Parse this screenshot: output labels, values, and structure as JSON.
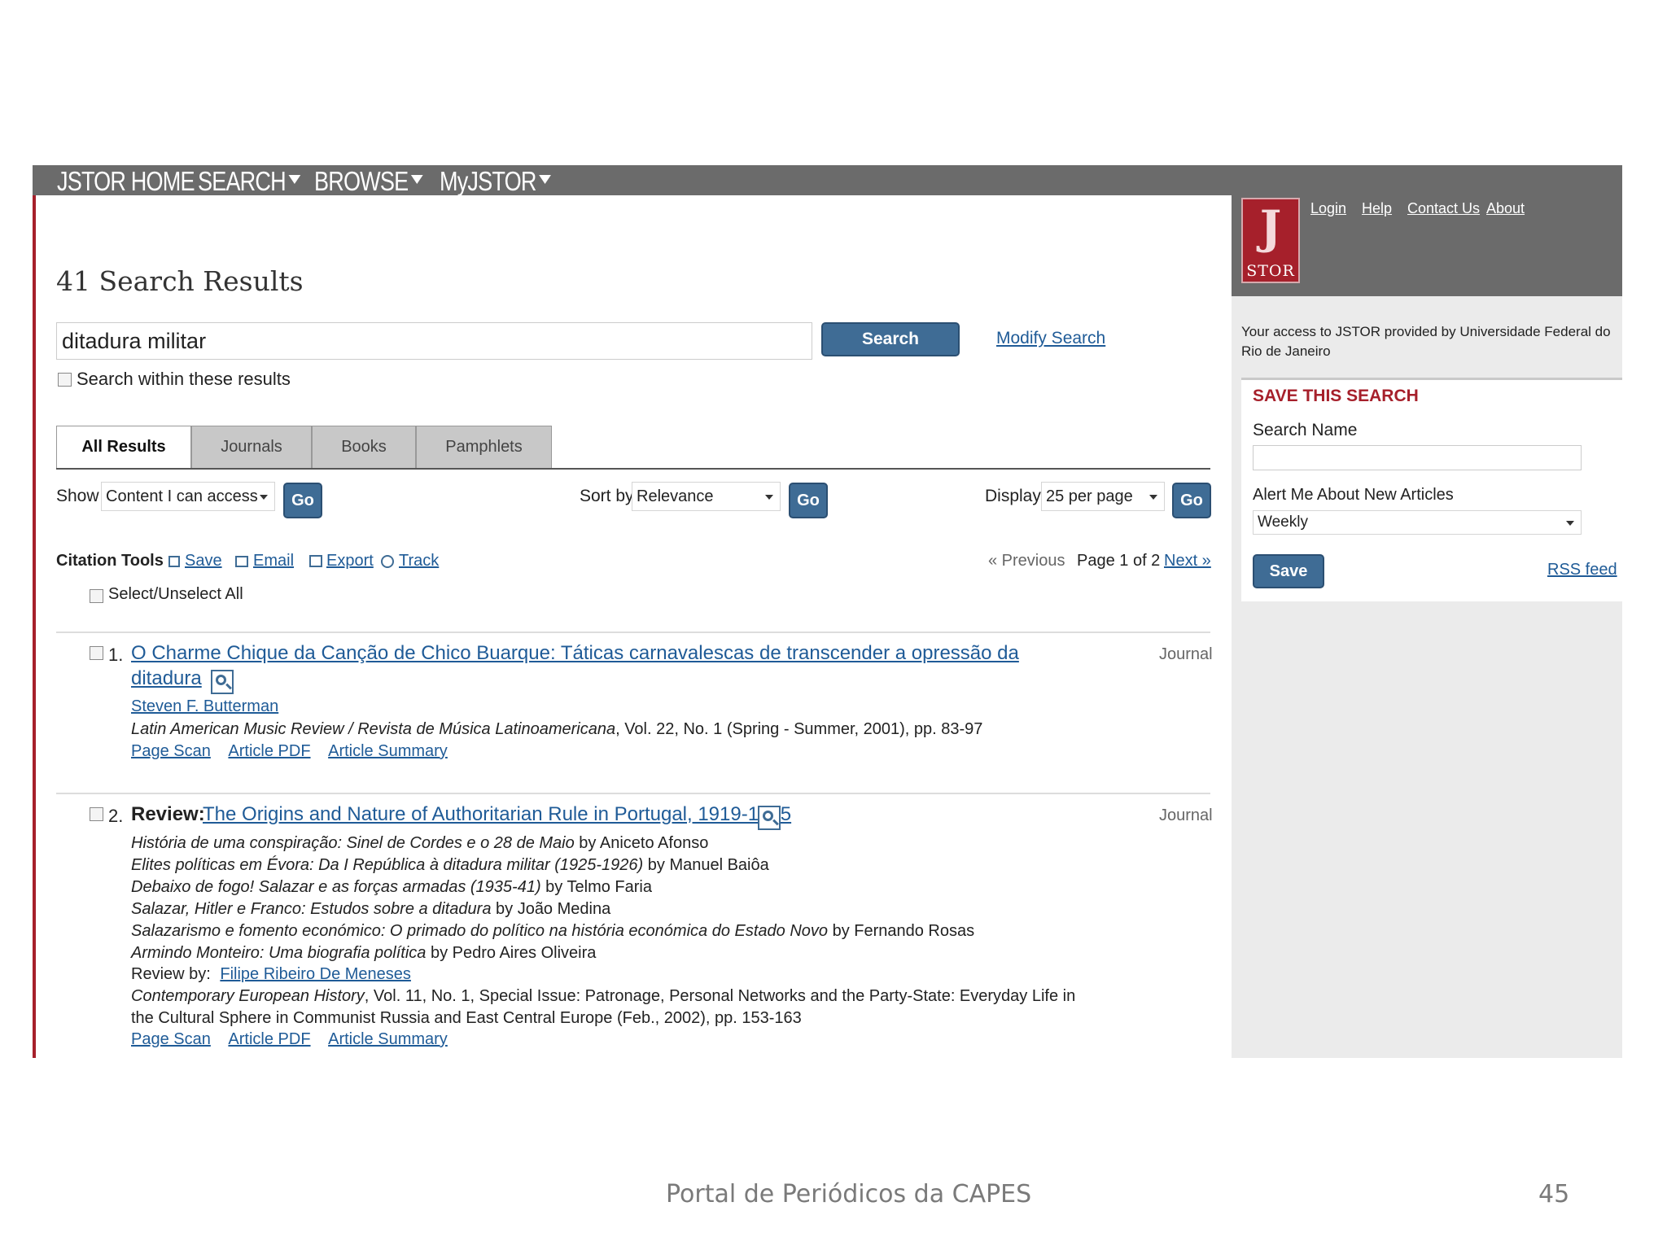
{
  "nav": {
    "home": "JSTOR HOME",
    "search": "SEARCH",
    "browse": "BROWSE",
    "myjstor": "MyJSTOR"
  },
  "header": {
    "title": "41 Search Results"
  },
  "search": {
    "query": "ditadura militar",
    "button": "Search",
    "modify": "Modify Search",
    "within": "Search within these results"
  },
  "tabs": [
    "All Results",
    "Journals",
    "Books",
    "Pamphlets"
  ],
  "filters": {
    "show_label": "Show",
    "show_value": "Content I can access",
    "sort_label": "Sort by",
    "sort_value": "Relevance",
    "display_label": "Display",
    "display_value": "25 per page",
    "go": "Go"
  },
  "tools": {
    "label": "Citation Tools",
    "save": "Save",
    "email": "Email",
    "export": "Export",
    "track": "Track",
    "select_all": "Select/Unselect All",
    "previous": "« Previous",
    "page": "Page 1 of 2",
    "next": "Next »"
  },
  "results": [
    {
      "num": "1.",
      "title_line1": "O Charme Chique da Canção de Chico Buarque: Táticas carnavalescas de transcender a opressão da",
      "title_line2": "ditadura",
      "type": "Journal",
      "author": "Steven F. Butterman",
      "journal": "Latin American Music Review / Revista de Música Latinoamericana",
      "citation": ", Vol. 22, No. 1 (Spring - Summer, 2001), pp. 83-97",
      "links": [
        "Page Scan",
        "Article PDF",
        "Article Summary"
      ]
    },
    {
      "num": "2.",
      "prefix": "Review:",
      "title": "The Origins and Nature of Authoritarian Rule in Portugal, 1919-1945",
      "type": "Journal",
      "books": [
        {
          "title": "História de uma conspiração: Sinel de Cordes e o 28 de Maio",
          "author": " by Aniceto Afonso"
        },
        {
          "title": "Elites políticas em Évora: Da I República à ditadura militar (1925-1926)",
          "author": " by Manuel Baiôa"
        },
        {
          "title": "Debaixo de fogo! Salazar e as forças armadas (1935-41)",
          "author": " by Telmo Faria"
        },
        {
          "title": "Salazar, Hitler e Franco: Estudos sobre a ditadura",
          "author": " by João Medina"
        },
        {
          "title": "Salazarismo e fomento económico: O primado do político na história económica do Estado Novo",
          "author": " by Fernando Rosas"
        },
        {
          "title": "Armindo Monteiro: Uma biografia política",
          "author": " by Pedro Aires Oliveira"
        }
      ],
      "review_by_label": "Review by:",
      "reviewer": "Filipe Ribeiro De Meneses",
      "journal": "Contemporary European History",
      "citation1": ", Vol. 11, No. 1, Special Issue: Patronage, Personal Networks and the Party-State: Everyday Life in",
      "citation2": "the Cultural Sphere in Communist Russia and East Central Europe (Feb., 2002), pp. 153-163",
      "links": [
        "Page Scan",
        "Article PDF",
        "Article Summary"
      ]
    }
  ],
  "sidebar": {
    "logo_j": "J",
    "logo_stor": "STOR",
    "links": [
      "Login",
      "Help",
      "Contact Us",
      "About"
    ],
    "access": "Your access to JSTOR provided by Universidade Federal do Rio de Janeiro",
    "save_title": "SAVE THIS SEARCH",
    "search_name_label": "Search Name",
    "alert_label": "Alert Me About New Articles",
    "alert_value": "Weekly",
    "save_button": "Save",
    "rss": "RSS feed"
  },
  "footer": {
    "text": "Portal de Periódicos da CAPES",
    "page": "45"
  }
}
